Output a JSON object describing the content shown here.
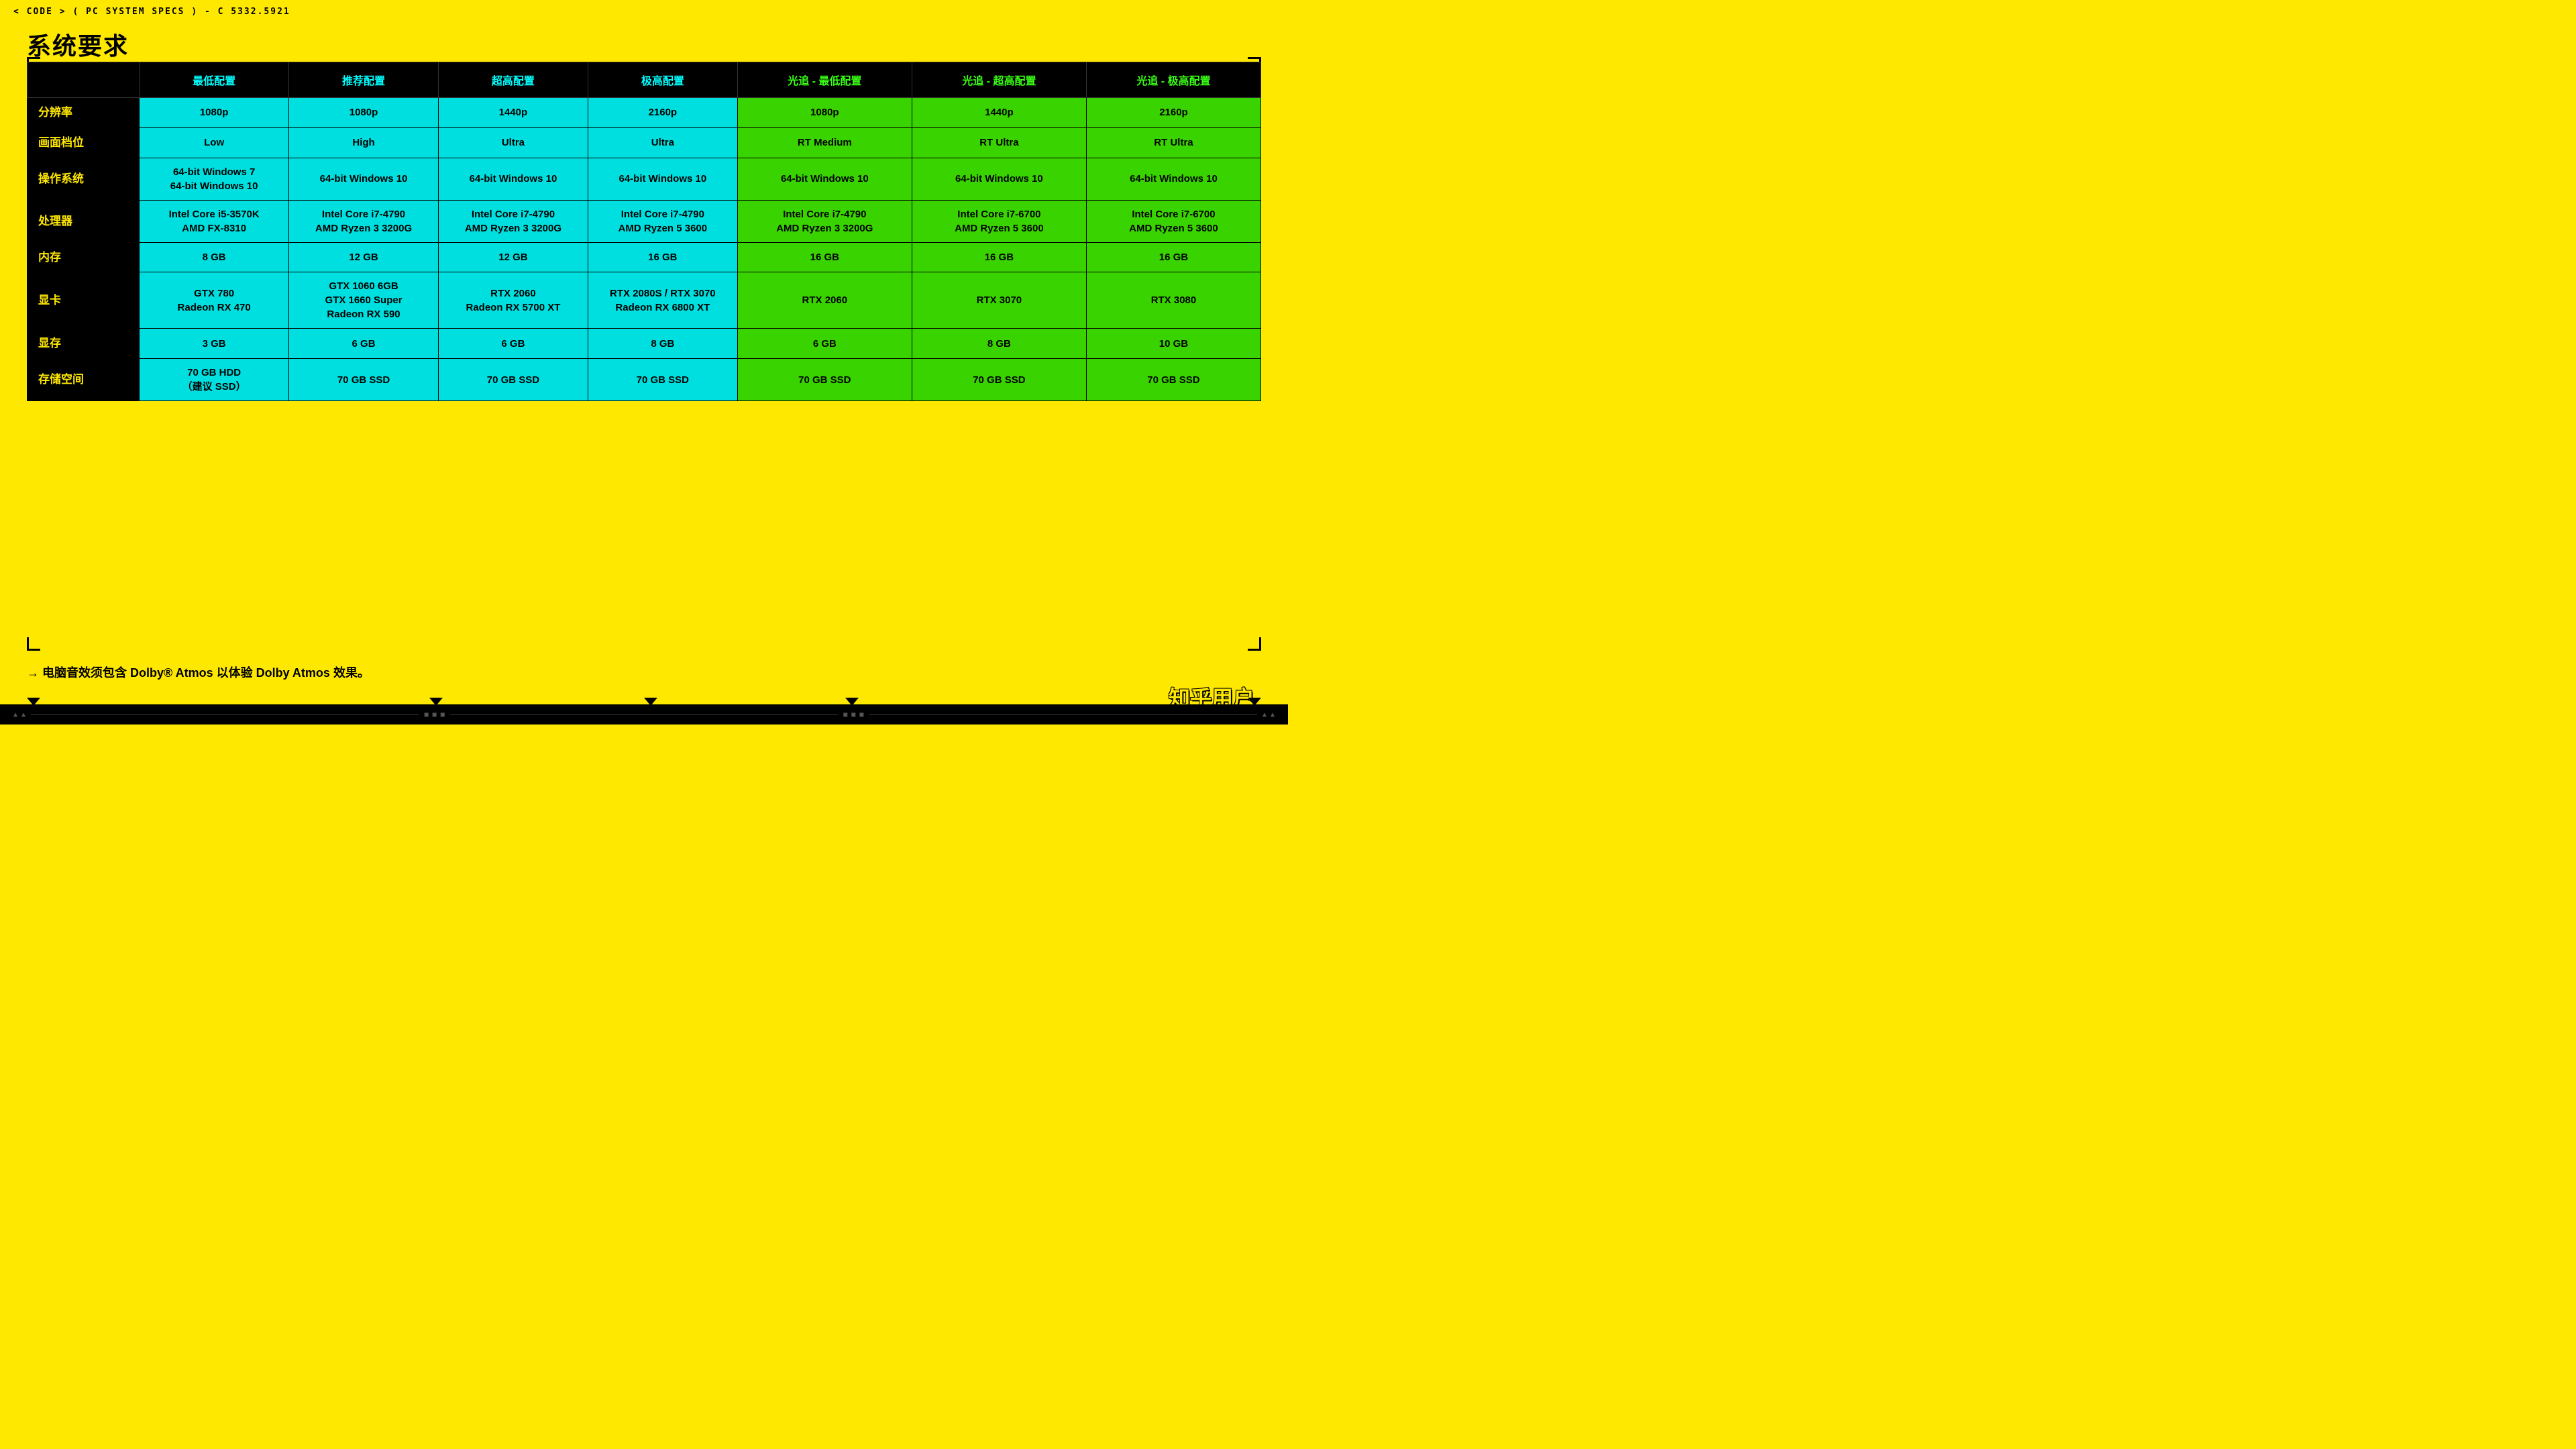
{
  "header": {
    "breadcrumb": "< CODE > ( PC SYSTEM SPECS ) - C 5332.5921",
    "title": "系统要求"
  },
  "table": {
    "columns": [
      {
        "label": "",
        "type": "label"
      },
      {
        "label": "最低配置",
        "type": "cyan"
      },
      {
        "label": "推荐配置",
        "type": "cyan"
      },
      {
        "label": "超高配置",
        "type": "cyan"
      },
      {
        "label": "极高配置",
        "type": "cyan"
      },
      {
        "label": "光追 - 最低配置",
        "type": "green"
      },
      {
        "label": "光追 - 超高配置",
        "type": "green"
      },
      {
        "label": "光追 - 极高配置",
        "type": "green"
      }
    ],
    "rows": [
      {
        "label": "分辨率",
        "cells": [
          "1080p",
          "1080p",
          "1440p",
          "2160p",
          "1080p",
          "1440p",
          "2160p"
        ]
      },
      {
        "label": "画面档位",
        "cells": [
          "Low",
          "High",
          "Ultra",
          "Ultra",
          "RT Medium",
          "RT Ultra",
          "RT Ultra"
        ]
      },
      {
        "label": "操作系统",
        "cells": [
          "64-bit Windows 7\n64-bit Windows 10",
          "64-bit Windows 10",
          "64-bit Windows 10",
          "64-bit Windows 10",
          "64-bit Windows 10",
          "64-bit Windows 10",
          "64-bit Windows 10"
        ]
      },
      {
        "label": "处理器",
        "cells": [
          "Intel Core i5-3570K\nAMD FX-8310",
          "Intel Core i7-4790\nAMD Ryzen 3 3200G",
          "Intel Core i7-4790\nAMD Ryzen 3 3200G",
          "Intel Core i7-4790\nAMD Ryzen 5 3600",
          "Intel Core i7-4790\nAMD Ryzen 3 3200G",
          "Intel Core i7-6700\nAMD Ryzen 5 3600",
          "Intel Core i7-6700\nAMD Ryzen 5 3600"
        ]
      },
      {
        "label": "内存",
        "cells": [
          "8 GB",
          "12 GB",
          "12 GB",
          "16 GB",
          "16 GB",
          "16 GB",
          "16 GB"
        ]
      },
      {
        "label": "显卡",
        "cells": [
          "GTX 780\nRadeon RX 470",
          "GTX 1060 6GB\nGTX 1660 Super\nRadeon RX 590",
          "RTX 2060\nRadeon RX 5700 XT",
          "RTX 2080S / RTX 3070\nRadeon RX 6800 XT",
          "RTX 2060",
          "RTX 3070",
          "RTX 3080"
        ]
      },
      {
        "label": "显存",
        "cells": [
          "3 GB",
          "6 GB",
          "6 GB",
          "8 GB",
          "6 GB",
          "8 GB",
          "10 GB"
        ]
      },
      {
        "label": "存储空间",
        "cells": [
          "70 GB HDD\n（建议 SSD）",
          "70 GB SSD",
          "70 GB SSD",
          "70 GB SSD",
          "70 GB SSD",
          "70 GB SSD",
          "70 GB SSD"
        ]
      }
    ]
  },
  "footnote": "→ 电脑音效须包含 Dolby® Atmos 以体验 Dolby Atmos 效果。",
  "watermark": "知乎用户"
}
